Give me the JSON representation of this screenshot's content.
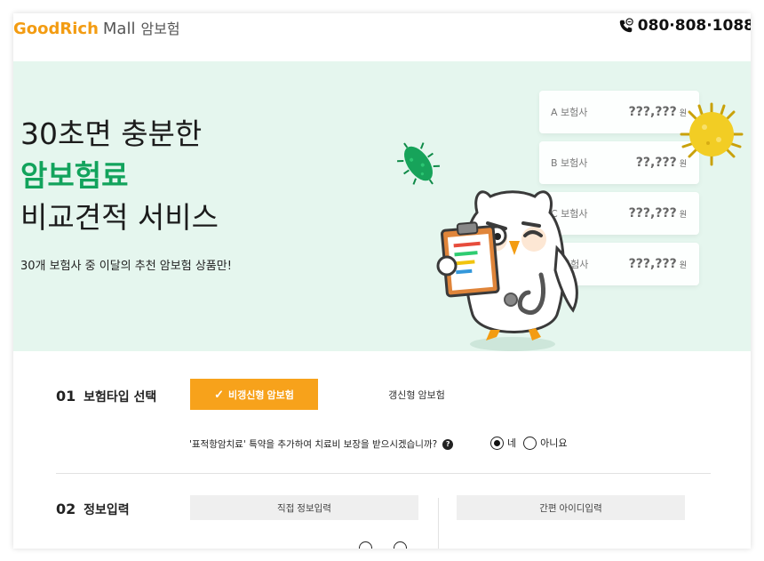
{
  "header": {
    "logo_brand": "GoodRich",
    "logo_mall": "Mall",
    "logo_kor": "암보험",
    "phone": "080·808·1088"
  },
  "hero": {
    "title_line1": "30초면 충분한",
    "title_line2": "암보험료",
    "title_line3": "비교견적 서비스",
    "subtitle": "30개 보험사 중 이달의 추천 암보험 상품만!",
    "quotes": [
      {
        "company": "A 보험사",
        "price": "???,???",
        "unit": "원"
      },
      {
        "company": "B 보험사",
        "price": "??,???",
        "unit": "원"
      },
      {
        "company": "C 보험사",
        "price": "???,???",
        "unit": "원"
      },
      {
        "company": "D 보험사",
        "price": "???,???",
        "unit": "원"
      }
    ]
  },
  "section1": {
    "num": "01",
    "title": "보험타입 선택",
    "option_selected": "비갱신형 암보험",
    "option_other": "갱신형 암보험",
    "question": "'표적항암치료' 특약을 추가하여 치료비 보장을 받으시겠습니까?",
    "help": "?",
    "radio_yes": "네",
    "radio_no": "아니요"
  },
  "section2": {
    "num": "02",
    "title": "정보입력",
    "tab_direct": "직접 정보입력",
    "tab_simple": "간편 아이디입력"
  },
  "colors": {
    "brand_orange": "#f7a21b",
    "brand_green": "#12a35c",
    "hero_bg": "#e5f6ee"
  }
}
